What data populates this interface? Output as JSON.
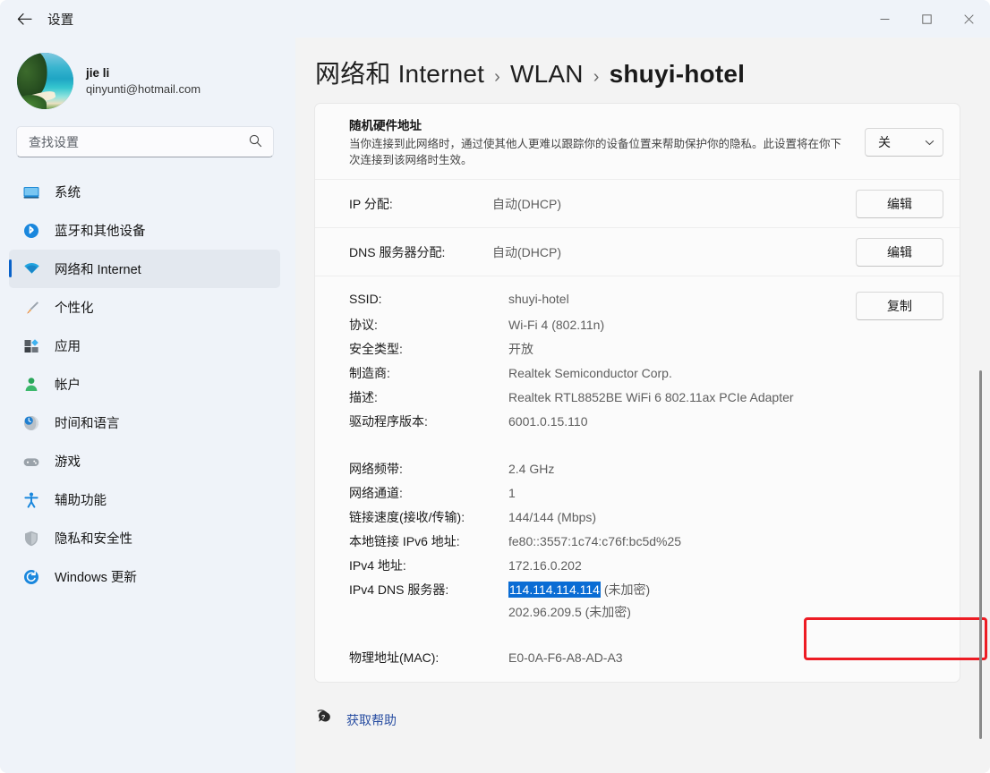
{
  "window": {
    "title": "设置",
    "back_icon": "back-arrow-icon",
    "controls": {
      "minimize": "–",
      "maximize": "☐",
      "close": "✕"
    }
  },
  "sidebar": {
    "account": {
      "name": "jie li",
      "email": "qinyunti@hotmail.com",
      "avatar": "beach-photo-avatar"
    },
    "search": {
      "placeholder": "查找设置",
      "value": "",
      "icon": "search-icon"
    },
    "items": [
      {
        "label": "系统",
        "icon": "monitor-icon",
        "active": false
      },
      {
        "label": "蓝牙和其他设备",
        "icon": "bluetooth-icon",
        "active": false
      },
      {
        "label": "网络和 Internet",
        "icon": "wifi-icon",
        "active": true
      },
      {
        "label": "个性化",
        "icon": "paintbrush-icon",
        "active": false
      },
      {
        "label": "应用",
        "icon": "apps-icon",
        "active": false
      },
      {
        "label": "帐户",
        "icon": "person-icon",
        "active": false
      },
      {
        "label": "时间和语言",
        "icon": "clock-globe-icon",
        "active": false
      },
      {
        "label": "游戏",
        "icon": "gamepad-icon",
        "active": false
      },
      {
        "label": "辅助功能",
        "icon": "accessibility-icon",
        "active": false
      },
      {
        "label": "隐私和安全性",
        "icon": "shield-icon",
        "active": false
      },
      {
        "label": "Windows 更新",
        "icon": "update-refresh-icon",
        "active": false
      }
    ]
  },
  "content": {
    "breadcrumb": [
      {
        "label": "网络和 Internet",
        "current": false
      },
      {
        "label": "WLAN",
        "current": false
      },
      {
        "label": "shuyi-hotel",
        "current": true
      }
    ],
    "breadcrumb_separator": "›",
    "random_hw": {
      "title": "随机硬件地址",
      "description": "当你连接到此网络时，通过使其他人更难以跟踪你的设备位置来帮助保护你的隐私。此设置将在你下次连接到该网络时生效。",
      "dropdown_value": "关",
      "dropdown_icon": "chevron-down-icon"
    },
    "assignment_rows": [
      {
        "label": "IP 分配:",
        "value": "自动(DHCP)",
        "button": "编辑"
      },
      {
        "label": "DNS 服务器分配:",
        "value": "自动(DHCP)",
        "button": "编辑"
      }
    ],
    "copy_button": "复制",
    "details_group_1": [
      {
        "label": "SSID:",
        "value": "shuyi-hotel"
      },
      {
        "label": "协议:",
        "value": "Wi-Fi 4 (802.11n)"
      },
      {
        "label": "安全类型:",
        "value": "开放"
      },
      {
        "label": "制造商:",
        "value": "Realtek Semiconductor Corp."
      },
      {
        "label": "描述:",
        "value": "Realtek RTL8852BE WiFi 6 802.11ax PCIe Adapter"
      },
      {
        "label": "驱动程序版本:",
        "value": "6001.0.15.110"
      }
    ],
    "details_group_2": [
      {
        "label": "网络频带:",
        "value": "2.4 GHz"
      },
      {
        "label": "网络通道:",
        "value": "1"
      },
      {
        "label": "链接速度(接收/传输):",
        "value": "144/144 (Mbps)"
      },
      {
        "label": "本地链接 IPv6 地址:",
        "value": "fe80::3557:1c74:c76f:bc5d%25"
      },
      {
        "label": "IPv4 地址:",
        "value": "172.16.0.202"
      }
    ],
    "dns": {
      "label": "IPv4 DNS 服务器:",
      "primary_address": "114.114.114.114",
      "primary_suffix": " (未加密)",
      "primary_selected": true,
      "secondary": "202.96.209.5 (未加密)",
      "highlight_color": "#ED1C24",
      "selection_color": "#0A6CD4"
    },
    "mac_row": {
      "label": "物理地址(MAC):",
      "value": "E0-0A-F6-A8-AD-A3"
    },
    "help": {
      "label": "获取帮助",
      "icon": "help-question-icon"
    }
  }
}
